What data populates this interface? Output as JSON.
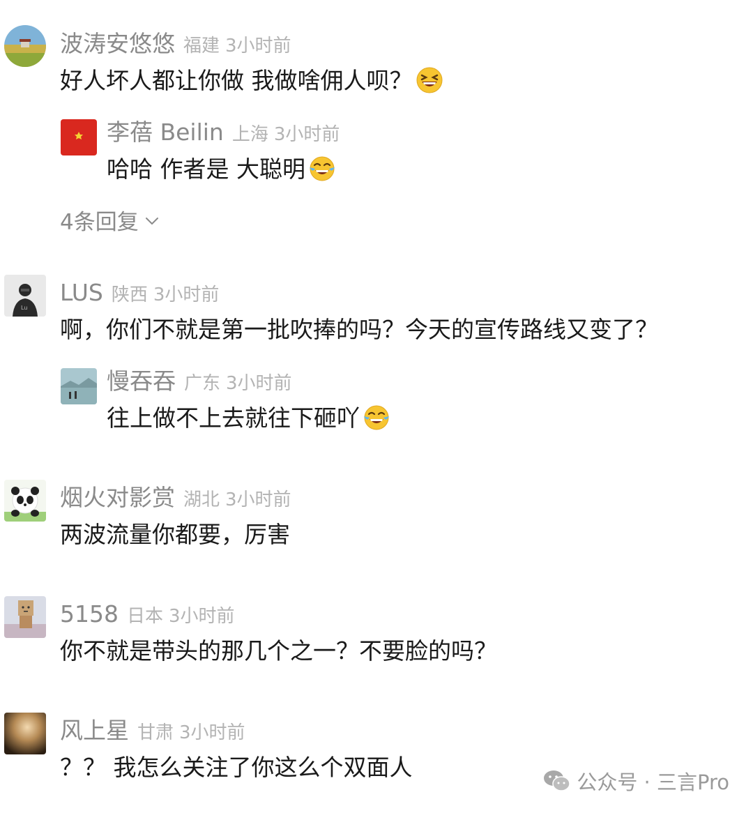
{
  "comments": [
    {
      "name": "波涛安悠悠",
      "location": "福建",
      "time": "3小时前",
      "text": "好人坏人都让你做  我做啥佣人呗？",
      "emoji": "grinning-squint-emoji",
      "reply": {
        "name": "李蓓 Beilin",
        "location": "上海",
        "time": "3小时前",
        "text": "哈哈 作者是 大聪明",
        "emoji": "tears-of-joy-emoji"
      },
      "more_replies": "4条回复"
    },
    {
      "name": "LUS",
      "location": "陕西",
      "time": "3小时前",
      "text": "啊，你们不就是第一批吹捧的吗？今天的宣传路线又变了？",
      "reply": {
        "name": "慢吞吞",
        "location": "广东",
        "time": "3小时前",
        "text": "往上做不上去就往下砸吖",
        "emoji": "tears-of-joy-emoji"
      }
    },
    {
      "name": "烟火对影赏",
      "location": "湖北",
      "time": "3小时前",
      "text": "两波流量你都要，厉害"
    },
    {
      "name": "5158",
      "location": "日本",
      "time": "3小时前",
      "text": "你不就是带头的那几个之一？不要脸的吗？"
    },
    {
      "name": "风上星",
      "location": "甘肃",
      "time": "3小时前",
      "text": "？？ 我怎么关注了你这么个双面人"
    }
  ],
  "watermark": {
    "text": "公众号 · 三言Pro",
    "icon": "wechat-icon"
  },
  "colors": {
    "name": "#8a8a8a",
    "meta": "#b3b3b3",
    "text": "#1a1a1a"
  }
}
